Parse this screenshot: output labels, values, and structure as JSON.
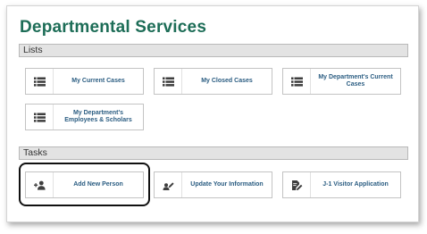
{
  "page_title": "Departmental Services",
  "lists": {
    "header": "Lists",
    "items": [
      {
        "label": "My Current Cases",
        "icon": "list-icon"
      },
      {
        "label": "My Closed Cases",
        "icon": "list-icon"
      },
      {
        "label": "My Department's Current Cases",
        "icon": "list-icon"
      },
      {
        "label": "My Department's Employees & Scholars",
        "icon": "list-icon"
      }
    ]
  },
  "tasks": {
    "header": "Tasks",
    "items": [
      {
        "label": "Add New Person",
        "icon": "add-person-icon"
      },
      {
        "label": "Update Your Information",
        "icon": "edit-person-icon"
      },
      {
        "label": "J-1 Visitor Application",
        "icon": "edit-document-icon"
      }
    ]
  },
  "colors": {
    "title": "#1d6d57",
    "tile_label": "#2b5d82",
    "icon": "#3e3e3e",
    "section_bar": "#e3e3e3"
  }
}
